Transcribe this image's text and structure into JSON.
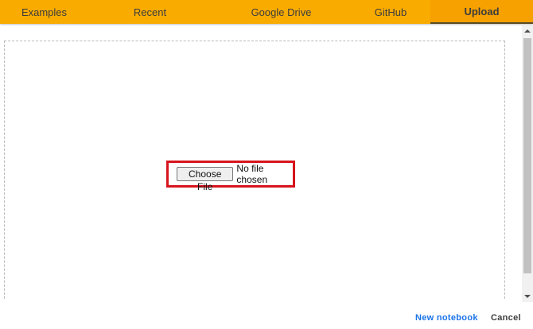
{
  "tabs": [
    {
      "label": "Examples"
    },
    {
      "label": "Recent"
    },
    {
      "label": "Google Drive"
    },
    {
      "label": "GitHub"
    },
    {
      "label": "Upload",
      "active": true
    }
  ],
  "upload": {
    "choose_file_label": "Choose File",
    "file_status": "No file chosen"
  },
  "footer": {
    "new_notebook_label": "New notebook",
    "cancel_label": "Cancel"
  },
  "colors": {
    "tab_bar": "#f9ab00",
    "highlight_box": "#d7141c",
    "link_blue": "#1a73e8"
  }
}
